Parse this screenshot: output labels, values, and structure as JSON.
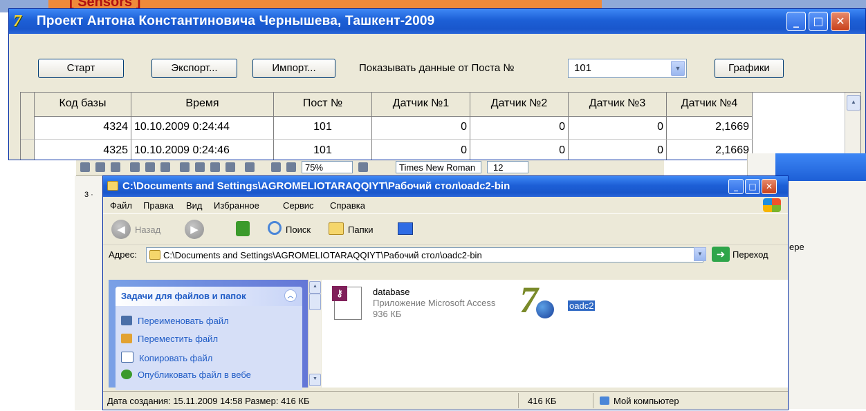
{
  "background": {
    "tab_text": "[ Sensors ]"
  },
  "app_window": {
    "title": "Проект Антона Константиновича Чернышева, Ташкент-2009",
    "controls": {
      "minimize": "_",
      "maximize": "□",
      "close": "✕"
    },
    "buttons": {
      "start": "Старт",
      "export": "Экспорт...",
      "import": "Импорт...",
      "charts": "Графики"
    },
    "post_label": "Показывать данные от Поста №",
    "post_value": "101",
    "table": {
      "headers": [
        "Код базы",
        "Время",
        "Пост №",
        "Датчик №1",
        "Датчик №2",
        "Датчик №3",
        "Датчик №4"
      ],
      "rows": [
        [
          "4324",
          "10.10.2009 0:24:44",
          "101",
          "0",
          "0",
          "0",
          "2,1669"
        ],
        [
          "4325",
          "10.10.2009 0:24:46",
          "101",
          "0",
          "0",
          "0",
          "2,1669"
        ]
      ]
    }
  },
  "word_toolbar": {
    "zoom": "75%",
    "font": "Times New Roman",
    "size": "12",
    "ruler_mark": "3 ·",
    "partial_text": "ере"
  },
  "explorer": {
    "title": "C:\\Documents and Settings\\AGROMELIOTARAQQIYT\\Рабочий стол\\oadc2-bin",
    "menu": [
      "Файл",
      "Правка",
      "Вид",
      "Избранное",
      "Сервис",
      "Справка"
    ],
    "toolbar": {
      "back": "Назад",
      "search": "Поиск",
      "folders": "Папки"
    },
    "address_label": "Адрес:",
    "address_value": "C:\\Documents and Settings\\AGROMELIOTARAQQIYT\\Рабочий стол\\oadc2-bin",
    "go_label": "Переход",
    "tasks": {
      "header": "Задачи для файлов и папок",
      "items": [
        "Переименовать файл",
        "Переместить файл",
        "Копировать файл",
        "Опубликовать файл в вебе"
      ]
    },
    "files": [
      {
        "name": "database",
        "type": "Приложение Microsoft Access",
        "size": "936 КБ",
        "icon": "access-file-icon"
      },
      {
        "name": "oadc2",
        "icon": "app-7-icon",
        "selected": true
      }
    ],
    "status": {
      "info": "Дата создания: 15.11.2009 14:58 Размер: 416 КБ",
      "size": "416 КБ",
      "zone": "Мой компьютер"
    }
  }
}
